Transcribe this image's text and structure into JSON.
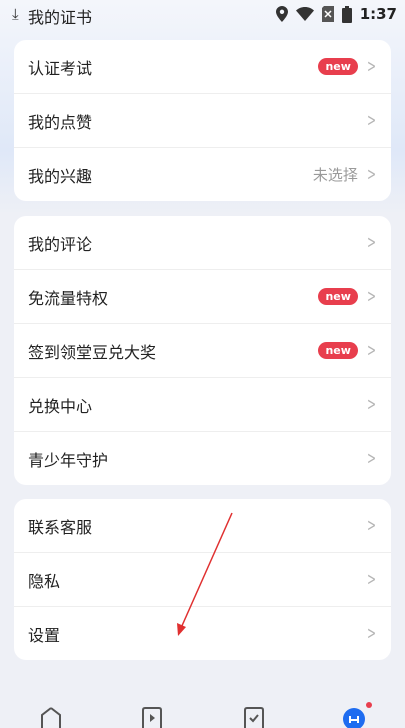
{
  "status_bar": {
    "title": "我的证书",
    "time": "1:37"
  },
  "colors": {
    "accent_badge": "#e83e4d",
    "arrow": "#e03030",
    "tab_active": "#1e6cf0"
  },
  "groups": [
    {
      "items": [
        {
          "label": "认证考试",
          "badge": "new",
          "value": null
        },
        {
          "label": "我的点赞",
          "badge": null,
          "value": null
        },
        {
          "label": "我的兴趣",
          "badge": null,
          "value": "未选择"
        }
      ]
    },
    {
      "items": [
        {
          "label": "我的评论",
          "badge": null,
          "value": null
        },
        {
          "label": "免流量特权",
          "badge": "new",
          "value": null
        },
        {
          "label": "签到领堂豆兑大奖",
          "badge": "new",
          "value": null
        },
        {
          "label": "兑换中心",
          "badge": null,
          "value": null
        },
        {
          "label": "青少年守护",
          "badge": null,
          "value": null
        }
      ]
    },
    {
      "items": [
        {
          "label": "联系客服",
          "badge": null,
          "value": null
        },
        {
          "label": "隐私",
          "badge": null,
          "value": null
        },
        {
          "label": "设置",
          "badge": null,
          "value": null
        }
      ]
    }
  ],
  "icons": [
    "download-icon",
    "location-icon",
    "wifi-icon",
    "sim-icon",
    "battery-icon",
    "chevron-right-icon",
    "home-tab-icon",
    "play-tab-icon",
    "check-tab-icon",
    "profile-tab-icon"
  ]
}
